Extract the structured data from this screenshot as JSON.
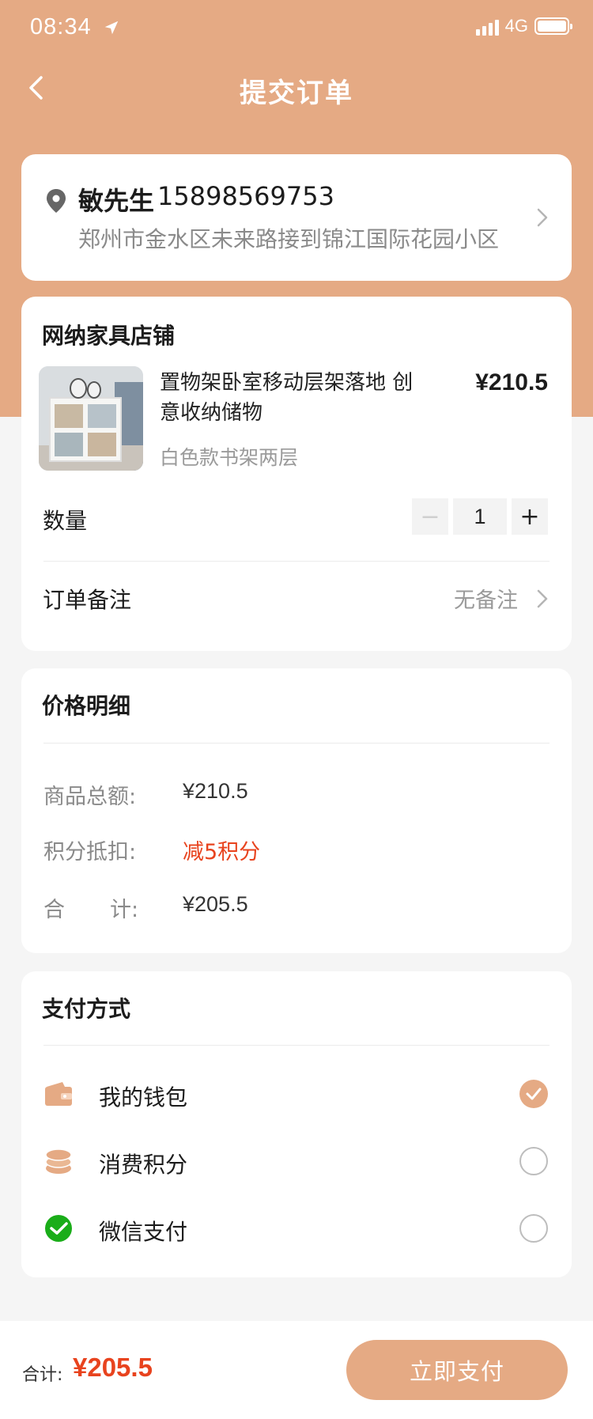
{
  "status_bar": {
    "time": "08:34",
    "network": "4G"
  },
  "header": {
    "title": "提交订单"
  },
  "address": {
    "name": "敏先生",
    "phone": "15898569753",
    "detail": "郑州市金水区未来路接到锦江国际花园小区"
  },
  "order": {
    "shop_name": "网纳家具店铺",
    "product": {
      "title": "置物架卧室移动层架落地 创意收纳储物",
      "spec": "白色款书架两层",
      "price": "¥210.5"
    },
    "quantity_label": "数量",
    "quantity": "1",
    "minus_symbol": "−",
    "plus_symbol": "+",
    "remark_label": "订单备注",
    "remark_value": "无备注"
  },
  "price_detail": {
    "title": "价格明细",
    "goods_total_label": "商品总额:",
    "goods_total_value": "¥210.5",
    "points_label": "积分抵扣:",
    "points_value": "减5积分",
    "total_label_a": "合",
    "total_label_b": "计:",
    "total_value": "¥205.5"
  },
  "payment": {
    "title": "支付方式",
    "options": [
      {
        "label": "我的钱包",
        "icon": "wallet-icon",
        "selected": true
      },
      {
        "label": "消费积分",
        "icon": "coins-icon",
        "selected": false
      },
      {
        "label": "微信支付",
        "icon": "wechat-icon",
        "selected": false
      }
    ]
  },
  "footer": {
    "total_label": "合计:",
    "total_value": "¥205.5",
    "submit_label": "立即支付"
  },
  "colors": {
    "accent": "#e5aa84",
    "price_red": "#e8431e",
    "wechat_green": "#1aad19"
  }
}
